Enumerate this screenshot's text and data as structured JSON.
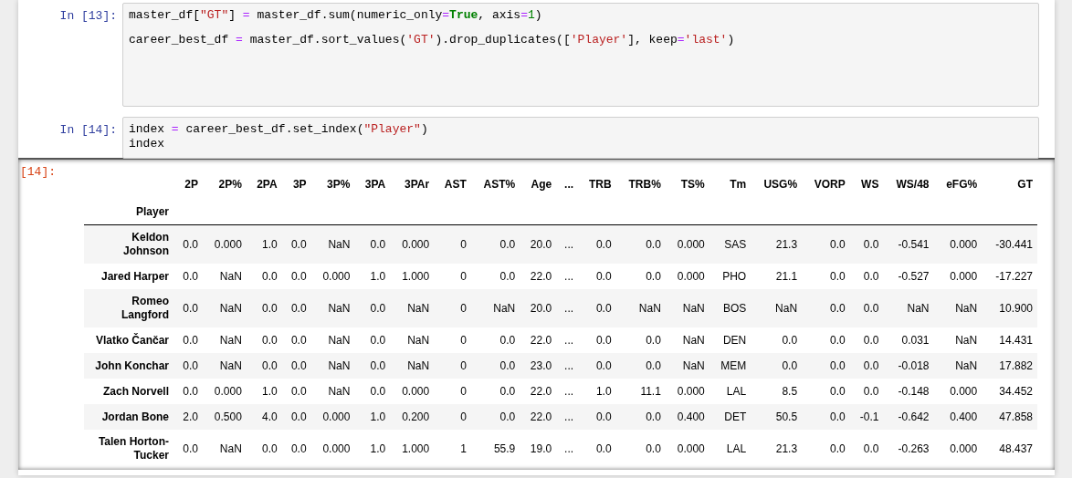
{
  "cells": [
    {
      "prompt": "In [13]:",
      "lines": [
        [
          {
            "kind": "name",
            "text": "master_df["
          },
          {
            "kind": "string",
            "text": "\"GT\""
          },
          {
            "kind": "name",
            "text": "] "
          },
          {
            "kind": "operator",
            "text": "="
          },
          {
            "kind": "name",
            "text": " master_df.sum(numeric_only"
          },
          {
            "kind": "operator",
            "text": "="
          },
          {
            "kind": "keyword",
            "text": "True"
          },
          {
            "kind": "name",
            "text": ", axis"
          },
          {
            "kind": "operator",
            "text": "="
          },
          {
            "kind": "number",
            "text": "1"
          },
          {
            "kind": "name",
            "text": ")"
          }
        ],
        [
          {
            "kind": "name",
            "text": "career_best_df "
          },
          {
            "kind": "operator",
            "text": "="
          },
          {
            "kind": "name",
            "text": " master_df.sort_values("
          },
          {
            "kind": "string",
            "text": "'GT'"
          },
          {
            "kind": "name",
            "text": ").drop_duplicates(["
          },
          {
            "kind": "string",
            "text": "'Player'"
          },
          {
            "kind": "name",
            "text": "], keep"
          },
          {
            "kind": "operator",
            "text": "="
          },
          {
            "kind": "string",
            "text": "'last'"
          },
          {
            "kind": "name",
            "text": ")"
          }
        ]
      ]
    },
    {
      "prompt": "In [14]:",
      "lines": [
        [
          {
            "kind": "name",
            "text": "index "
          },
          {
            "kind": "operator",
            "text": "="
          },
          {
            "kind": "name",
            "text": " career_best_df.set_index("
          },
          {
            "kind": "string",
            "text": "\"Player\""
          },
          {
            "kind": "name",
            "text": ")"
          }
        ],
        [
          {
            "kind": "name",
            "text": "index"
          }
        ]
      ]
    }
  ],
  "output": {
    "prompt": "[14]:",
    "table": {
      "index_name": "Player",
      "columns": [
        "2P",
        "2P%",
        "2PA",
        "3P",
        "3P%",
        "3PA",
        "3PAr",
        "AST",
        "AST%",
        "Age",
        "...",
        "TRB",
        "TRB%",
        "TS%",
        "Tm",
        "USG%",
        "VORP",
        "WS",
        "WS/48",
        "eFG%",
        "GT"
      ],
      "rows": [
        {
          "player": "Keldon Johnson",
          "cells": [
            "0.0",
            "0.000",
            "1.0",
            "0.0",
            "NaN",
            "0.0",
            "0.000",
            "0",
            "0.0",
            "20.0",
            "...",
            "0.0",
            "0.0",
            "0.000",
            "SAS",
            "21.3",
            "0.0",
            "0.0",
            "-0.541",
            "0.000",
            "-30.441"
          ]
        },
        {
          "player": "Jared Harper",
          "cells": [
            "0.0",
            "NaN",
            "0.0",
            "0.0",
            "0.000",
            "1.0",
            "1.000",
            "0",
            "0.0",
            "22.0",
            "...",
            "0.0",
            "0.0",
            "0.000",
            "PHO",
            "21.1",
            "0.0",
            "0.0",
            "-0.527",
            "0.000",
            "-17.227"
          ]
        },
        {
          "player": "Romeo Langford",
          "cells": [
            "0.0",
            "NaN",
            "0.0",
            "0.0",
            "NaN",
            "0.0",
            "NaN",
            "0",
            "NaN",
            "20.0",
            "...",
            "0.0",
            "NaN",
            "NaN",
            "BOS",
            "NaN",
            "0.0",
            "0.0",
            "NaN",
            "NaN",
            "10.900"
          ]
        },
        {
          "player": "Vlatko Čančar",
          "cells": [
            "0.0",
            "NaN",
            "0.0",
            "0.0",
            "NaN",
            "0.0",
            "NaN",
            "0",
            "0.0",
            "22.0",
            "...",
            "0.0",
            "0.0",
            "NaN",
            "DEN",
            "0.0",
            "0.0",
            "0.0",
            "0.031",
            "NaN",
            "14.431"
          ]
        },
        {
          "player": "John Konchar",
          "cells": [
            "0.0",
            "NaN",
            "0.0",
            "0.0",
            "NaN",
            "0.0",
            "NaN",
            "0",
            "0.0",
            "23.0",
            "...",
            "0.0",
            "0.0",
            "NaN",
            "MEM",
            "0.0",
            "0.0",
            "0.0",
            "-0.018",
            "NaN",
            "17.882"
          ]
        },
        {
          "player": "Zach Norvell",
          "cells": [
            "0.0",
            "0.000",
            "1.0",
            "0.0",
            "NaN",
            "0.0",
            "0.000",
            "0",
            "0.0",
            "22.0",
            "...",
            "1.0",
            "11.1",
            "0.000",
            "LAL",
            "8.5",
            "0.0",
            "0.0",
            "-0.148",
            "0.000",
            "34.452"
          ]
        },
        {
          "player": "Jordan Bone",
          "cells": [
            "2.0",
            "0.500",
            "4.0",
            "0.0",
            "0.000",
            "1.0",
            "0.200",
            "0",
            "0.0",
            "22.0",
            "...",
            "0.0",
            "0.0",
            "0.400",
            "DET",
            "50.5",
            "0.0",
            "-0.1",
            "-0.642",
            "0.400",
            "47.858"
          ]
        },
        {
          "player": "Talen Horton-Tucker",
          "cells": [
            "0.0",
            "NaN",
            "0.0",
            "0.0",
            "0.000",
            "1.0",
            "1.000",
            "1",
            "55.9",
            "19.0",
            "...",
            "0.0",
            "0.0",
            "0.000",
            "LAL",
            "21.3",
            "0.0",
            "0.0",
            "-0.263",
            "0.000",
            "48.437"
          ]
        }
      ]
    }
  }
}
